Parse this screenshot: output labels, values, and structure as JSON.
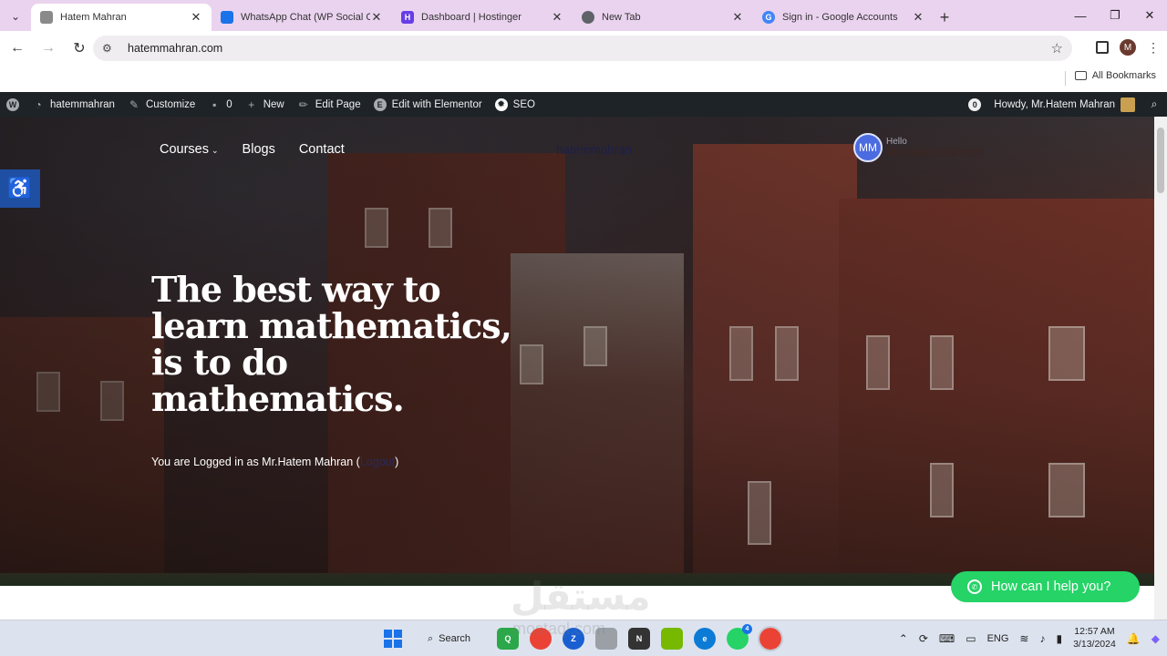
{
  "browser": {
    "tabs": [
      {
        "title": "Hatem Mahran",
        "active": true,
        "favicon_color": "#8a8a8a"
      },
      {
        "title": "WhatsApp Chat (WP Social Chat",
        "active": false,
        "favicon_color": "#1a73e8"
      },
      {
        "title": "Dashboard | Hostinger",
        "active": false,
        "favicon_color": "#673de6"
      },
      {
        "title": "New Tab",
        "active": false,
        "favicon_color": "#5f6368"
      },
      {
        "title": "Sign in - Google Accounts",
        "active": false,
        "favicon_color": "#4285f4"
      }
    ],
    "url": "hatemmahran.com",
    "profile_initial": "M",
    "bookmarks_label": "All Bookmarks"
  },
  "adminbar": {
    "site": "hatemmahran",
    "customize": "Customize",
    "comments": "0",
    "new": "New",
    "edit_page": "Edit Page",
    "elementor": "Edit with Elementor",
    "seo": "SEO",
    "notif_count": "0",
    "howdy": "Howdy, Mr.Hatem Mahran"
  },
  "site": {
    "nav": [
      {
        "label": "Courses",
        "has_dropdown": true
      },
      {
        "label": "Blogs",
        "has_dropdown": false
      },
      {
        "label": "Contact",
        "has_dropdown": false
      }
    ],
    "site_name": "hatemmahran",
    "user_badge": "MM",
    "hello": "Hello",
    "user_name": "Mr.Hatem Mahran",
    "headline": "The best way to learn mathematics, is to do mathematics.",
    "logged_prefix": "You are Logged in as Mr.Hatem Mahran (",
    "logout": "Logout",
    "logged_suffix": ")",
    "whatsapp_label": "How can I help you?"
  },
  "watermark": {
    "arabic": "مستقل",
    "latin": "mostaql.com"
  },
  "taskbar": {
    "search_label": "Search",
    "language": "ENG",
    "time": "12:57 AM",
    "date": "3/13/2024",
    "whatsapp_badge": "4"
  },
  "colors": {
    "admin_bar": "#1d2327",
    "accent_whatsapp": "#25d366",
    "accessibility": "#1f4fa3",
    "tab_strip": "#ead3ef"
  }
}
